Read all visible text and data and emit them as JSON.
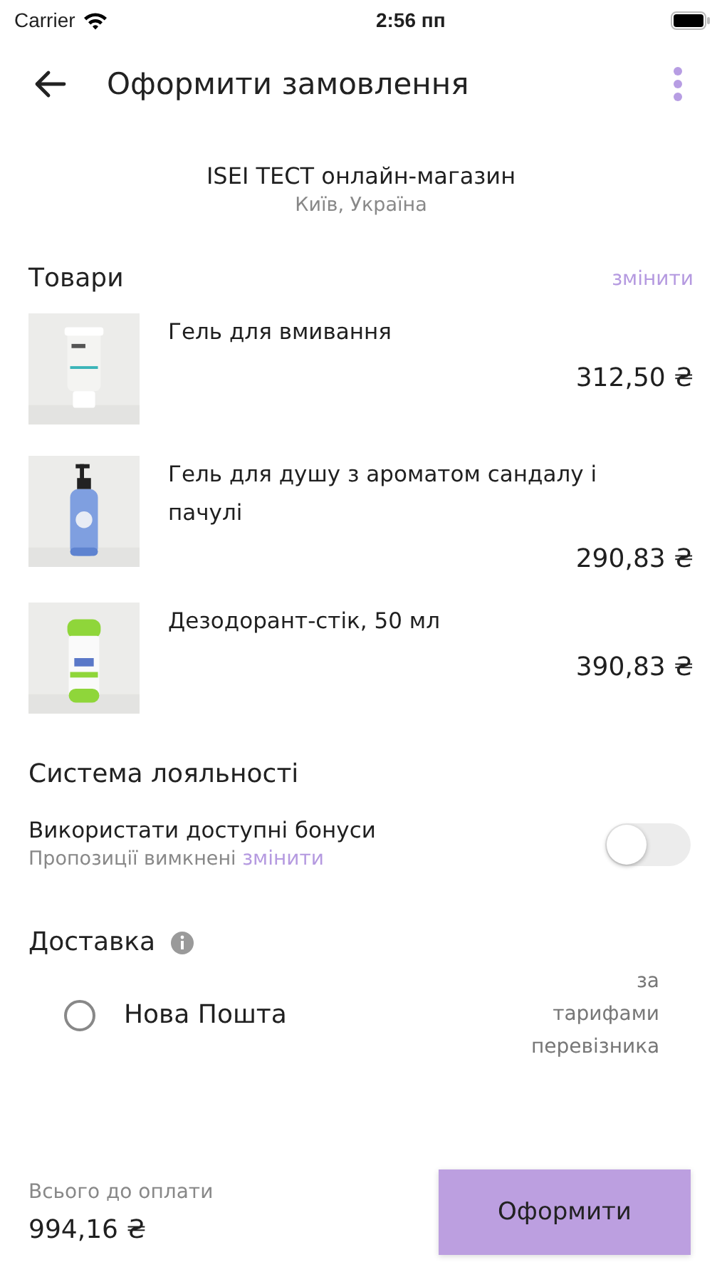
{
  "status_bar": {
    "carrier": "Carrier",
    "time": "2:56 пп"
  },
  "header": {
    "title": "Оформити замовлення"
  },
  "shop": {
    "name": "ISEI ТЕСТ онлайн-магазин",
    "location": "Київ, Україна"
  },
  "products": {
    "title": "Товари",
    "action": "змінити",
    "items": [
      {
        "name": "Гель для вмивання",
        "price": "312,50 ₴"
      },
      {
        "name": "Гель для душу з ароматом сандалу і пачулі",
        "price": "290,83 ₴"
      },
      {
        "name": "Дезодорант-стік, 50 мл",
        "price": "390,83 ₴"
      }
    ]
  },
  "loyalty": {
    "title": "Система лояльності",
    "label": "Використати доступні бонуси",
    "note": "Пропозиції вимкнені",
    "note_link": "змінити",
    "on": false
  },
  "delivery": {
    "title": "Доставка",
    "options": [
      {
        "name": "Нова Пошта",
        "price": "за тарифами перевізника",
        "selected": false
      }
    ]
  },
  "footer": {
    "total_label": "Всього до оплати",
    "total": "994,16 ₴",
    "button": "Оформити"
  }
}
